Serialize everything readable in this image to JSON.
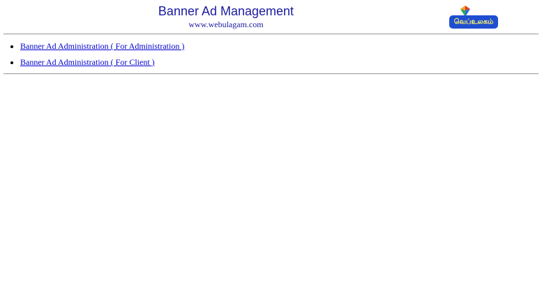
{
  "header": {
    "title": "Banner Ad Management",
    "subtitle": "www.webulagam.com",
    "logo_text": "வெப்உலகம்",
    "logo_colors": {
      "badge": "#1f4fd0",
      "text": "#fff36a",
      "gem": [
        "#e23b2a",
        "#f6a21a",
        "#2fa84f",
        "#2d6be0"
      ]
    }
  },
  "links": [
    {
      "label": "Banner Ad Administration ( For Administration )"
    },
    {
      "label": "Banner Ad Administration ( For Client )"
    }
  ],
  "colors": {
    "title": "#1a1aa0",
    "link": "#0000cc",
    "rule": "#a8a8a8"
  }
}
